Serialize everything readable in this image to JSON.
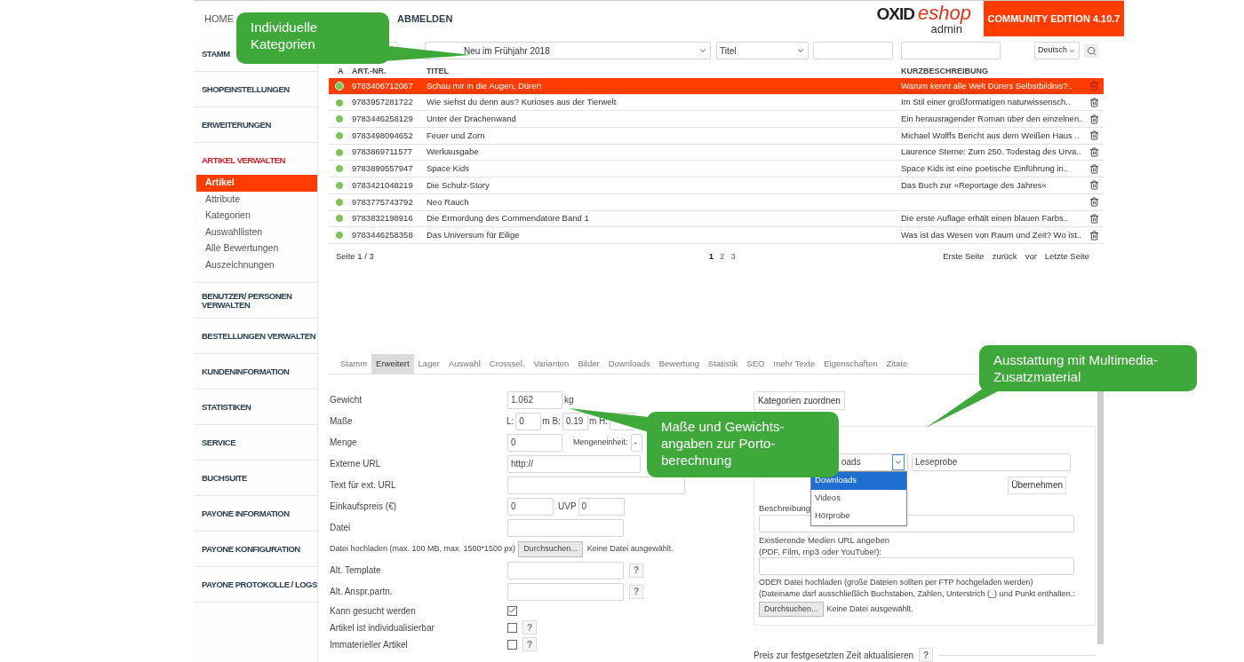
{
  "header": {
    "nav": [
      "HOME",
      "ABMELDEN"
    ],
    "logo": {
      "brand": "OXID",
      "product": "eshop",
      "sub": "admin"
    },
    "edition": "COMMUNITY EDITION 4.10.7"
  },
  "sidebar": [
    {
      "label": "STAMM",
      "expanded": false
    },
    {
      "label": "SHOPEINSTELLUNGEN",
      "expanded": false
    },
    {
      "label": "ERWEITERUNGEN",
      "expanded": false
    },
    {
      "label": "ARTIKEL VERWALTEN",
      "expanded": true,
      "children": [
        {
          "label": "Artikel",
          "selected": true
        },
        {
          "label": "Attribute",
          "selected": false
        },
        {
          "label": "Kategorien",
          "selected": false
        },
        {
          "label": "Auswahllisten",
          "selected": false
        },
        {
          "label": "Alle Bewertungen",
          "selected": false
        },
        {
          "label": "Auszeichnungen",
          "selected": false
        }
      ]
    },
    {
      "label": "BENUTZER/ PERSONEN VERWALTEN",
      "expanded": false
    },
    {
      "label": "BESTELLUNGEN VERWALTEN",
      "expanded": false
    },
    {
      "label": "KUNDENINFORMATION",
      "expanded": false
    },
    {
      "label": "STATISTIKEN",
      "expanded": false
    },
    {
      "label": "SERVICE",
      "expanded": false
    },
    {
      "label": "BUCHSUITE",
      "expanded": false
    },
    {
      "label": "PAYONE INFORMATION",
      "expanded": false
    },
    {
      "label": "PAYONE KONFIGURATION",
      "expanded": false
    },
    {
      "label": "PAYONE PROTOKOLLE / LOGS",
      "expanded": false
    }
  ],
  "filters": {
    "category": "Neu im Frühjahr 2018",
    "field": "Titel",
    "language": "Deutsch"
  },
  "table": {
    "columns": [
      "A",
      "ART.-NR.",
      "TITEL",
      "KURZBESCHREIBUNG"
    ],
    "rows": [
      {
        "active": true,
        "selected": true,
        "number": "9783406712067",
        "title": "Schau mir in die Augen, Dürer!",
        "description": "Warum kennt alle Welt Dürers Selbstbildnis?.."
      },
      {
        "active": true,
        "selected": false,
        "number": "9783957281722",
        "title": "Wie siehst du denn aus? Kurioses aus der Tierwelt",
        "description": "Im Stil einer großformatigen naturwissensch.."
      },
      {
        "active": true,
        "selected": false,
        "number": "9783446258129",
        "title": "Unter der Drachenwand",
        "description": "Ein herausragender Roman über den einzelnen.."
      },
      {
        "active": true,
        "selected": false,
        "number": "9783498094652",
        "title": "Feuer und Zorn",
        "description": "Michael Wolffs Bericht aus dem Weißen Haus .."
      },
      {
        "active": true,
        "selected": false,
        "number": "9783869711577",
        "title": "Werkausgabe",
        "description": "Laurence Sterne: Zum 250. Todestag des Urva.."
      },
      {
        "active": true,
        "selected": false,
        "number": "9783899557947",
        "title": "Space Kids",
        "description": "Space Kids ist eine poetische Einführung in.."
      },
      {
        "active": true,
        "selected": false,
        "number": "9783421048219",
        "title": "Die Schulz-Story",
        "description": "Das Buch zur »Reportage des Jahres«"
      },
      {
        "active": true,
        "selected": false,
        "number": "9783775743792",
        "title": "Neo Rauch"
      },
      {
        "active": true,
        "selected": false,
        "number": "9783832198916",
        "title": "Die Ermordung des Commendatore Band 1",
        "description": "Die erste Auflage erhält einen blauen Farbs.."
      },
      {
        "active": true,
        "selected": false,
        "number": "9783446258358",
        "title": "Das Universum für Eilige",
        "description": "Was ist das Wesen von Raum und Zeit? Wo ist.."
      }
    ]
  },
  "pager": {
    "page": "Seite 1 / 3",
    "pages": [
      {
        "label": "1",
        "selected": true
      },
      {
        "label": "2",
        "selected": false
      },
      {
        "label": "3",
        "selected": false
      }
    ],
    "links": [
      "Erste Seite",
      "zurück",
      "vor",
      "Letzte Seite"
    ]
  },
  "tabs": [
    {
      "label": "Stamm",
      "selected": false
    },
    {
      "label": "Erweitert",
      "selected": true
    },
    {
      "label": "Lager",
      "selected": false
    },
    {
      "label": "Auswahl",
      "selected": false
    },
    {
      "label": "Crosssel.",
      "selected": false
    },
    {
      "label": "Varianten",
      "selected": false
    },
    {
      "label": "Bilder",
      "selected": false
    },
    {
      "label": "Downloads",
      "selected": false
    },
    {
      "label": "Bewertung",
      "selected": false
    },
    {
      "label": "Statistik",
      "selected": false
    },
    {
      "label": "SEO",
      "selected": false
    },
    {
      "label": "mehr Texte",
      "selected": false
    },
    {
      "label": "Eigenschaften",
      "selected": false
    },
    {
      "label": "Zitate",
      "selected": false
    }
  ],
  "form": [
    {
      "kind": "input",
      "label": "Gewicht",
      "value": "1.062",
      "unit": "kg"
    },
    {
      "kind": "dims",
      "label": "Maße",
      "parts": [
        {
          "prefix": "L:",
          "value": "0"
        },
        {
          "prefix": "m B:",
          "value": "0.19"
        },
        {
          "prefix": "m H:"
        }
      ]
    },
    {
      "kind": "quantity",
      "label": "Menge",
      "value": "0",
      "unit_label": "Mengeneinheit:",
      "unit": "-"
    },
    {
      "kind": "input",
      "label": "Externe URL",
      "value": "http://"
    },
    {
      "kind": "input",
      "label": "Text für ext. URL"
    },
    {
      "kind": "price",
      "label": "Einkaufspreis (€)",
      "value": "0",
      "extra_label": "UVP",
      "extra_value": "0"
    },
    {
      "kind": "input",
      "label": "Datei"
    },
    {
      "kind": "upload",
      "label": "Datei hochladen (max. 100 MB, max. 1500*1500 px)",
      "button": "Durchsuchen...",
      "status": "Keine Datei ausgewählt."
    },
    {
      "kind": "input",
      "label": "Alt. Template",
      "help": "?"
    },
    {
      "kind": "input",
      "label": "Alt. Anspr.partn.",
      "help": "?"
    },
    {
      "kind": "checkbox",
      "label": "Kann gesucht werden",
      "checked": true
    },
    {
      "kind": "checkbox",
      "label": "Artikel ist individualisierbar",
      "checked": false,
      "help": "?"
    },
    {
      "kind": "checkbox",
      "label": "Immaterieller Artikel",
      "checked": false,
      "help": "?"
    }
  ],
  "categories_button": "Kategorien zuordnen",
  "media": {
    "type_select": "oads",
    "options": [
      {
        "label": "Downloads",
        "selected": true
      },
      {
        "label": "Videos",
        "selected": false
      },
      {
        "label": "Hörprobe",
        "selected": false
      }
    ],
    "title_value": "Leseprobe",
    "apply_button": "Übernehmen",
    "description_label": "Beschreibung:",
    "url_label": "Existierende Medien URL angeben",
    "url_hint": "(PDF, Film, mp3 oder YouTube!):",
    "upload_label": "ODER Datei hochladen (große Dateien sollten per FTP hochgeladen werden)",
    "upload_hint": "(Dateiname darf ausschließlich Buchstaben, Zahlen, Unterstrich (_) und Punkt enthalten.:",
    "browse_button": "Durchsuchen...",
    "file_status": "Keine Datei ausgewählt."
  },
  "price_update": {
    "label": "Preis zur festgesetzten Zeit aktualisieren",
    "help": "?"
  },
  "callouts": [
    {
      "text": "Individuelle\nKategorien"
    },
    {
      "text": "Maße und Gewichts-\nangaben zur Porto-\nberechnung"
    },
    {
      "text": "Ausstattung mit Multimedia-\nZusatzmaterial"
    }
  ]
}
